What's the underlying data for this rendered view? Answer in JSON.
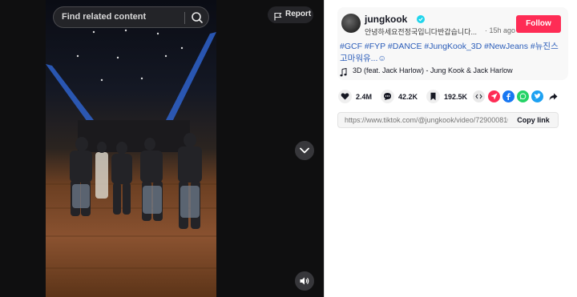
{
  "search": {
    "placeholder": "Find related content"
  },
  "report": {
    "label": "Report"
  },
  "video": {
    "icons": [
      "chevron-down-icon",
      "volume-icon"
    ]
  },
  "author": {
    "username": "jungkook",
    "nickname": "안녕하세요전정국입니다반갑습니다...",
    "time_ago": "· 15h ago",
    "follow_label": "Follow"
  },
  "caption": {
    "text": "#GCF #FYP #DANCE #JungKook_3D #NewJeans #뉴진스 고마워유...☺"
  },
  "music": {
    "title": "3D (feat. Jack Harlow) - Jung Kook & Jack Harlow"
  },
  "stats": {
    "likes": "2.4M",
    "comments": "42.2K",
    "saves": "192.5K"
  },
  "share": {
    "icons": [
      "embed-icon",
      "send-icon",
      "facebook-icon",
      "whatsapp-icon",
      "twitter-icon",
      "share-icon"
    ]
  },
  "link": {
    "url": "https://www.tiktok.com/@jungkook/video/7290008103...",
    "copy_label": "Copy link"
  },
  "colors": {
    "accent": "#fe2c55",
    "hashtag": "#2b5db9",
    "verified": "#20d5ec"
  }
}
